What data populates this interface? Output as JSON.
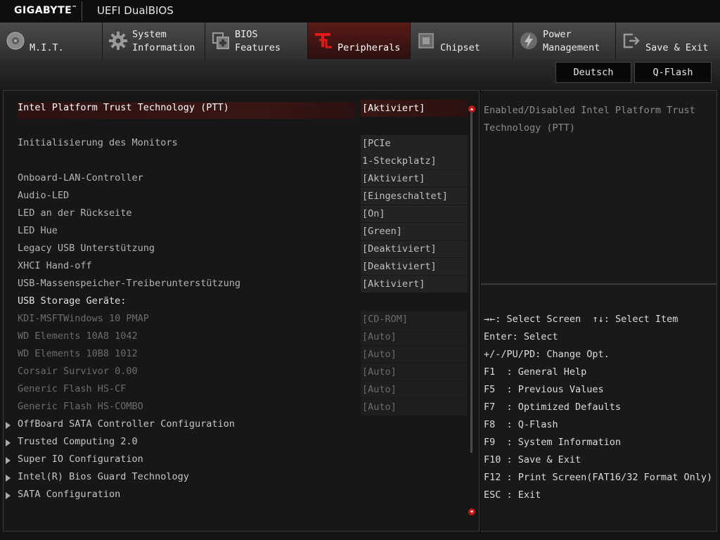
{
  "header": {
    "brand": "GIGABYTE",
    "brand_tm": "™",
    "product": "UEFI DualBIOS"
  },
  "tabs": [
    {
      "label": "M.I.T.",
      "icon": "mit-icon"
    },
    {
      "label": "System\nInformation",
      "icon": "system-info-icon"
    },
    {
      "label": "BIOS\nFeatures",
      "icon": "bios-features-icon"
    },
    {
      "label": "Peripherals",
      "icon": "peripherals-icon"
    },
    {
      "label": "Chipset",
      "icon": "chipset-icon"
    },
    {
      "label": "Power\nManagement",
      "icon": "power-icon"
    },
    {
      "label": "Save & Exit",
      "icon": "save-exit-icon"
    }
  ],
  "active_tab": "Peripherals",
  "toolbar": {
    "language": "Deutsch",
    "qflash": "Q-Flash"
  },
  "settings": [
    {
      "label": "Intel Platform Trust Technology (PTT)",
      "value": "[Aktiviert]"
    },
    {
      "label": "Initialisierung des Monitors",
      "value": "[PCIe",
      "value2": "1-Steckplatz]"
    },
    {
      "label": "Onboard-LAN-Controller",
      "value": "[Aktiviert]"
    },
    {
      "label": "Audio-LED",
      "value": "[Eingeschaltet]"
    },
    {
      "label": "LED an der Rückseite",
      "value": "[On]"
    },
    {
      "label": "LED Hue",
      "value": "[Green]"
    },
    {
      "label": "Legacy USB Unterstützung",
      "value": "[Deaktiviert]"
    },
    {
      "label": "XHCI Hand-off",
      "value": "[Deaktiviert]"
    },
    {
      "label": "USB-Massenspeicher-Treiberunterstützung",
      "value": "[Aktiviert]"
    }
  ],
  "usb_header": "USB Storage Geräte:",
  "usb_devices": [
    {
      "label": "KDI-MSFTWindows 10 PMAP",
      "value": "[CD-ROM]"
    },
    {
      "label": "WD Elements 10A8 1042",
      "value": "[Auto]"
    },
    {
      "label": "WD Elements 10B8 1012",
      "value": "[Auto]"
    },
    {
      "label": "Corsair Survivor 0.00",
      "value": "[Auto]"
    },
    {
      "label": "Generic Flash HS-CF",
      "value": "[Auto]"
    },
    {
      "label": "Generic Flash HS-COMBO",
      "value": "[Auto]"
    }
  ],
  "submenus": [
    "OffBoard SATA Controller Configuration",
    "Trusted Computing 2.0",
    "Super IO Configuration",
    "Intel(R) Bios Guard Technology",
    "SATA Configuration"
  ],
  "help": {
    "text": "Enabled/Disabled Intel Platform Trust Technology (PTT)"
  },
  "keys": {
    "nav": {
      "screen_sym": "→←",
      "screen_text": ": Select Screen",
      "item_sym": "↑↓",
      "item_text": ": Select Item"
    },
    "lines": [
      "Enter: Select",
      "+/-/PU/PD: Change Opt.",
      "F1  : General Help",
      "F5  : Previous Values",
      "F7  : Optimized Defaults",
      "F8  : Q-Flash",
      "F9  : System Information",
      "F10 : Save & Exit",
      "F12 : Print Screen(FAT16/32 Format Only)",
      "ESC : Exit"
    ]
  },
  "colors": {
    "accent": "#d11a1a",
    "active_tab": "#5a1a16",
    "background": "#171717"
  }
}
